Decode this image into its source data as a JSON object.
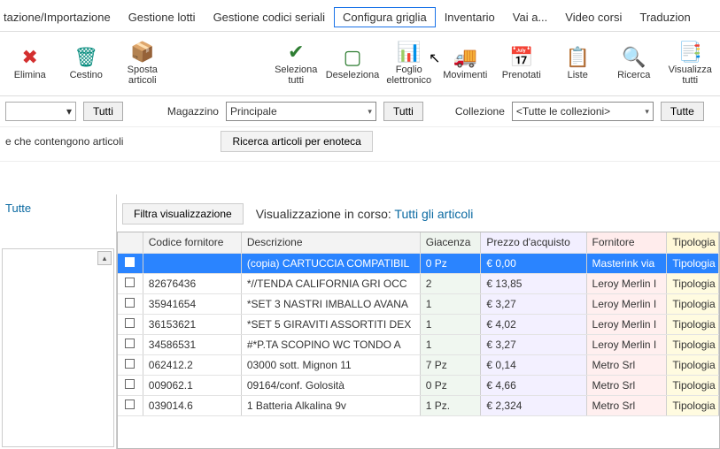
{
  "menu": {
    "items": [
      "tazione/Importazione",
      "Gestione lotti",
      "Gestione codici seriali",
      "Configura griglia",
      "Inventario",
      "Vai a...",
      "Video corsi",
      "Traduzion"
    ],
    "highlighted_index": 3
  },
  "toolbar": {
    "elimina": "Elimina",
    "cestino": "Cestino",
    "sposta": "Sposta articoli",
    "seleziona": "Seleziona tutti",
    "deseleziona": "Deseleziona",
    "foglio": "Foglio elettronico",
    "movimenti": "Movimenti",
    "prenotati": "Prenotati",
    "liste": "Liste",
    "ricerca": "Ricerca",
    "visualizza": "Visualizza tutti"
  },
  "filters": {
    "tutti1": "Tutti",
    "magazzino_lbl": "Magazzino",
    "magazzino_val": "Principale",
    "tutti2": "Tutti",
    "collezione_lbl": "Collezione",
    "collezione_val": "<Tutte le collezioni>",
    "tutte_btn": "Tutte",
    "contengono": "e che contengono articoli",
    "ricerca_enoteca": "Ricerca articoli per enoteca"
  },
  "left": {
    "tutte": "Tutte"
  },
  "vis": {
    "filtra": "Filtra visualizzazione",
    "label": "Visualizzazione in corso:",
    "value": "Tutti gli articoli"
  },
  "table": {
    "headers": {
      "codice": "Codice fornitore",
      "desc": "Descrizione",
      "giac": "Giacenza",
      "prezzo": "Prezzo d'acquisto",
      "forn": "Fornitore",
      "tip": "Tipologia"
    },
    "rows": [
      {
        "codice": "",
        "desc": "(copia) CARTUCCIA COMPATIBIL",
        "giac": "0 Pz",
        "prezzo": "€ 0,00",
        "forn": "Masterink via",
        "tip": "Tipologia",
        "selected": true
      },
      {
        "codice": "82676436",
        "desc": "*//TENDA CALIFORNIA GRI OCC",
        "giac": "2",
        "prezzo": "€ 13,85",
        "forn": "Leroy Merlin I",
        "tip": "Tipologia"
      },
      {
        "codice": "35941654",
        "desc": "*SET 3 NASTRI IMBALLO AVANA",
        "giac": "1",
        "prezzo": "€ 3,27",
        "forn": "Leroy Merlin I",
        "tip": "Tipologia"
      },
      {
        "codice": "36153621",
        "desc": "*SET 5 GIRAVITI ASSORTITI DEX",
        "giac": "1",
        "prezzo": "€ 4,02",
        "forn": "Leroy Merlin I",
        "tip": "Tipologia"
      },
      {
        "codice": "34586531",
        "desc": "#*P.TA SCOPINO WC TONDO A",
        "giac": "1",
        "prezzo": "€ 3,27",
        "forn": "Leroy Merlin I",
        "tip": "Tipologia"
      },
      {
        "codice": "062412.2",
        "desc": "03000 sott. Mignon 11",
        "giac": "7 Pz",
        "prezzo": "€ 0,14",
        "forn": "Metro Srl",
        "tip": "Tipologia"
      },
      {
        "codice": "009062.1",
        "desc": "09164/conf. Golosità",
        "giac": "0 Pz",
        "prezzo": "€ 4,66",
        "forn": "Metro Srl",
        "tip": "Tipologia"
      },
      {
        "codice": "039014.6",
        "desc": "1 Batteria Alkalina 9v",
        "giac": "1 Pz.",
        "prezzo": "€ 2,324",
        "forn": "Metro Srl",
        "tip": "Tipologia"
      }
    ]
  }
}
